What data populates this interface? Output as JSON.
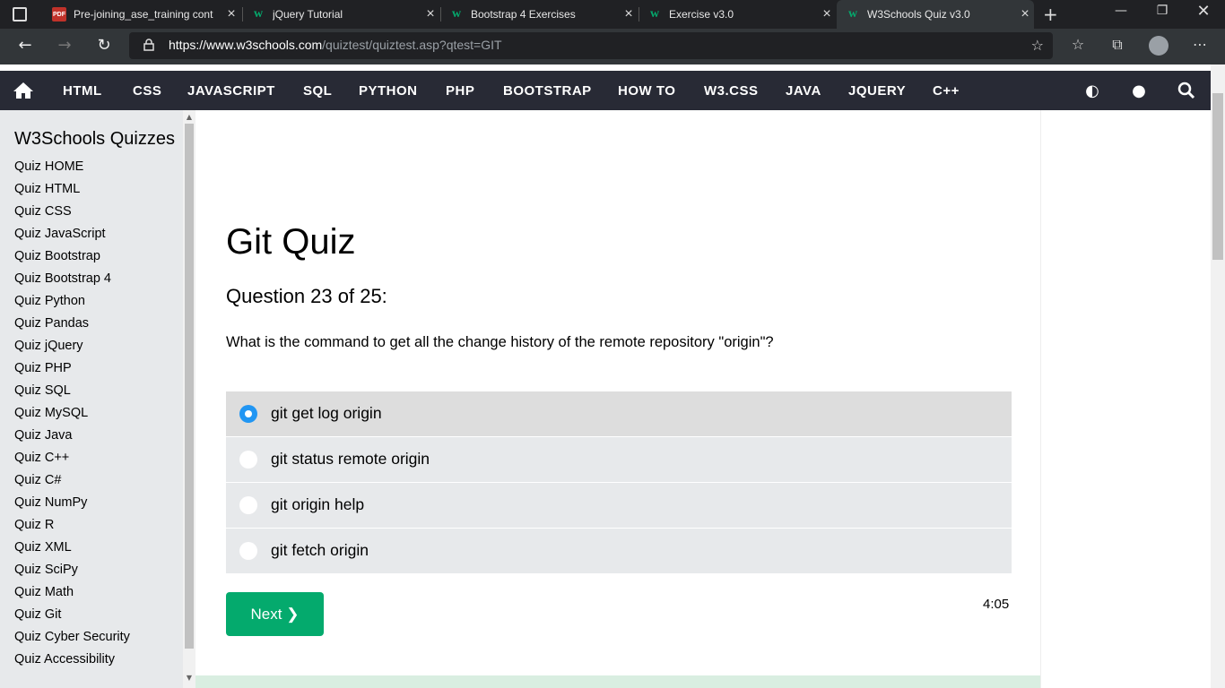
{
  "browser": {
    "tabs": [
      {
        "title": "Pre-joining_ase_training cont",
        "icon": "pdf-icon"
      },
      {
        "title": "jQuery Tutorial",
        "icon": "w3schools-icon"
      },
      {
        "title": "Bootstrap 4 Exercises",
        "icon": "w3schools-icon"
      },
      {
        "title": "Exercise v3.0",
        "icon": "w3schools-icon"
      },
      {
        "title": "W3Schools Quiz v3.0",
        "icon": "w3schools-icon",
        "active": true
      }
    ],
    "url_host": "https://www.w3schools.com",
    "url_path": "/quiztest/quiztest.asp?qtest=GIT",
    "pdf_badge": "PDF"
  },
  "nav": {
    "items": [
      "HTML",
      "CSS",
      "JAVASCRIPT",
      "SQL",
      "PYTHON",
      "PHP",
      "BOOTSTRAP",
      "HOW TO",
      "W3.CSS",
      "JAVA",
      "JQUERY",
      "C++"
    ]
  },
  "sidebar": {
    "heading": "W3Schools Quizzes",
    "links": [
      "Quiz HOME",
      "Quiz HTML",
      "Quiz CSS",
      "Quiz JavaScript",
      "Quiz Bootstrap",
      "Quiz Bootstrap 4",
      "Quiz Python",
      "Quiz Pandas",
      "Quiz jQuery",
      "Quiz PHP",
      "Quiz SQL",
      "Quiz MySQL",
      "Quiz Java",
      "Quiz C++",
      "Quiz C#",
      "Quiz NumPy",
      "Quiz R",
      "Quiz XML",
      "Quiz SciPy",
      "Quiz Math",
      "Quiz Git",
      "Quiz Cyber Security",
      "Quiz Accessibility"
    ]
  },
  "quiz": {
    "title": "Git Quiz",
    "question_number": "Question 23 of 25:",
    "question": "What is the command to get all the change history of the remote repository \"origin\"?",
    "options": [
      {
        "label": "git get log origin",
        "selected": true
      },
      {
        "label": "git status remote origin",
        "selected": false
      },
      {
        "label": "git origin help",
        "selected": false
      },
      {
        "label": "git fetch origin",
        "selected": false
      }
    ],
    "next_label": "Next ❯",
    "timer": "4:05"
  },
  "colors": {
    "accent": "#04aa6d",
    "nav_bg": "#282a35",
    "radio_selected": "#2196f3"
  }
}
